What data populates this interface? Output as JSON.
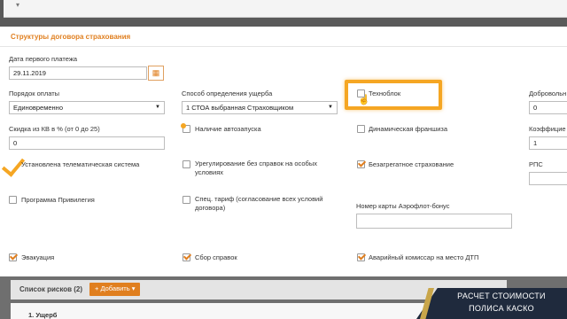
{
  "topbar": {
    "caret": "▾"
  },
  "panel": {
    "title": "Структуры договора страхования"
  },
  "fields": {
    "first_payment_date": {
      "label": "Дата первого платежа",
      "value": "29.11.2019"
    },
    "payment_order": {
      "label": "Порядок оплаты",
      "value": "Единовременно"
    },
    "damage_method": {
      "label": "Способ определения ущерба",
      "value": "1 СТОА выбранная Страховщиком"
    },
    "discount_kv": {
      "label": "Скидка из КВ в % (от 0 до 25)",
      "value": "0"
    },
    "deductible": {
      "label": "Добровольн",
      "value": "0"
    },
    "coefficient": {
      "label": "Коэффицие",
      "value": "1"
    },
    "rps": {
      "label": "РПС",
      "value": ""
    },
    "aeroflot_card": {
      "label": "Номер карты Аэрофлот-бонус",
      "value": ""
    }
  },
  "checkboxes": {
    "technoblock": {
      "label": "Техноблок",
      "checked": false
    },
    "autostart": {
      "label": "Наличие автозапуска",
      "checked": false
    },
    "dynamic_franchise": {
      "label": "Динамическая франшиза",
      "checked": false
    },
    "telematics": {
      "label": "Установлена телематическая система",
      "checked": true
    },
    "settlement_no_docs": {
      "label": "Урегулирование без справок на особых условиях",
      "checked": false
    },
    "non_aggregate": {
      "label": "Безагрегатное страхование",
      "checked": true
    },
    "privilege_program": {
      "label": "Программа Привилегия",
      "checked": false
    },
    "special_tariff": {
      "label": "Спец. тариф (согласование всех условий договора)",
      "checked": false
    },
    "evacuation": {
      "label": "Эвакуация",
      "checked": true
    },
    "docs_collection": {
      "label": "Сбор справок",
      "checked": true
    },
    "emergency_commissioner": {
      "label": "Аварийный комиссар на место ДТП",
      "checked": true
    }
  },
  "risks": {
    "title": "Список рисков (2)",
    "add_button": "+ Добавить ▾",
    "row1": "1. Ущерб"
  },
  "banner": {
    "line1": "РАСЧЕТ СТОИМОСТИ",
    "line2": "ПОЛИСА КАСКО"
  },
  "colors": {
    "accent": "#e07f1f",
    "highlight": "#f5a623",
    "banner": "#1f2a3d"
  }
}
